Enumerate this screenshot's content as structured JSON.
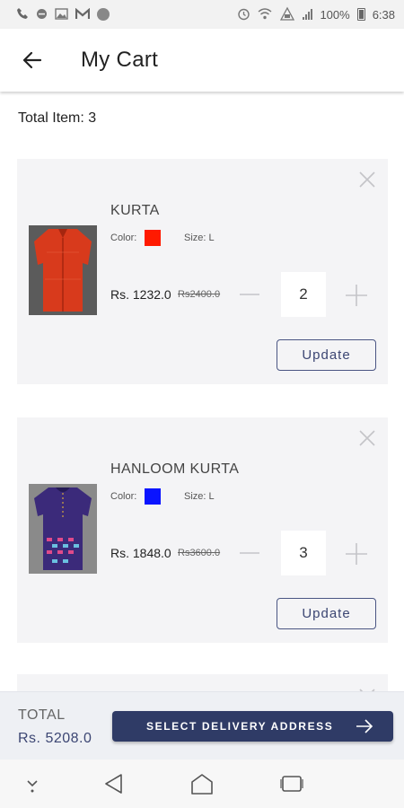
{
  "status_bar": {
    "battery": "100%",
    "time": "6:38"
  },
  "header": {
    "title": "My Cart",
    "back_icon": "arrow-left-icon"
  },
  "cart": {
    "total_items_label": "Total Item: 3",
    "items": [
      {
        "name": "KURTA",
        "color_label": "Color:",
        "color": "#ff1a00",
        "size_label": "Size: L",
        "price": "Rs. 1232.0",
        "old_price": "Rs2400.0",
        "quantity": "2",
        "update_label": "Update",
        "image_colors": {
          "main": "#d83a1c",
          "dark": "#a5260f",
          "bg": "#5a5a5a"
        }
      },
      {
        "name": "HANLOOM KURTA",
        "color_label": "Color:",
        "color": "#0a14ff",
        "size_label": "Size: L",
        "price": "Rs. 1848.0",
        "old_price": "Rs3600.0",
        "quantity": "3",
        "update_label": "Update",
        "image_colors": {
          "main": "#3b2a7a",
          "dark": "#241a55",
          "bg": "#777"
        }
      }
    ]
  },
  "checkout": {
    "total_label": "TOTAL",
    "total_value": "Rs. 5208.0",
    "button_label": "SELECT DELIVERY ADDRESS"
  },
  "colors": {
    "primary": "#2f3b66",
    "card_bg": "#f4f4f6",
    "accent_text": "#3c4673"
  }
}
